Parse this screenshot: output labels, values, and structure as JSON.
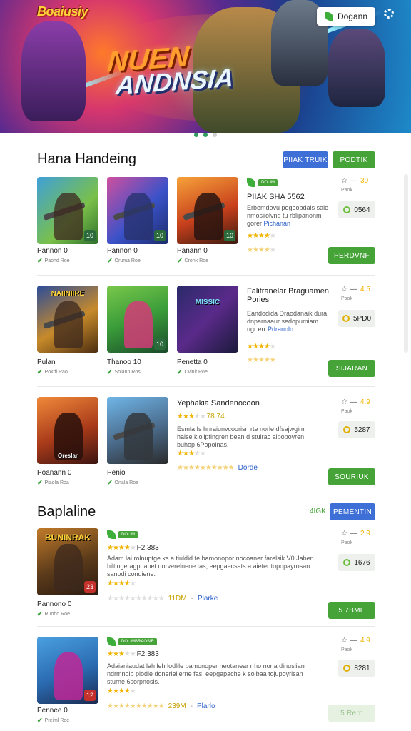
{
  "hero": {
    "logo": "Boaiusiy",
    "title_line1": "NUEN",
    "title_line2": "ANDNSIA",
    "login_label": "Dogann",
    "accent": "#1d8ac9"
  },
  "section1": {
    "title": "Hana Handeing",
    "btn_blue": "PIIAK TRUIK",
    "btn_green": "PODTIK",
    "rows": [
      {
        "games": [
          {
            "name": "Pannon 0",
            "sub": "Paohd Roe",
            "badge": "10"
          },
          {
            "name": "Pannon 0",
            "sub": "Oruma Roe",
            "badge": "10"
          },
          {
            "name": "Panann 0",
            "sub": "Cronk Roe",
            "badge": "10"
          }
        ],
        "tag": "DOLIM",
        "title": "PIIAK SHA 5562",
        "desc1": "Erbemdovu pogeobdals sale",
        "desc2": "nmosiiolvnq tu rblipanonm",
        "desc3": "gorer ",
        "desc_link": "Pichanan",
        "score": "30",
        "score_sub": "Paok",
        "pill": "0564",
        "action": "PERDVNF"
      },
      {
        "games": [
          {
            "name": "Pulan",
            "sub": "Pokdi Rao",
            "badge": "",
            "cap": "NAIINIIRE"
          },
          {
            "name": "Thanoo 10",
            "sub": "Solann Ros",
            "badge": "10"
          },
          {
            "name": "Penetta 0",
            "sub": "Cvinlt Roe",
            "badge": "",
            "cap": "MISSIC"
          }
        ],
        "title": "Falitranelar Braguamen",
        "title2": "Pories",
        "desc1": "Eandodida Draodanaik dura",
        "desc2": "dnparnaaur sedopumiam",
        "desc3": "ugr err ",
        "desc_link": "Pdranolo",
        "score": "4.5",
        "score_sub": "Paok",
        "pill": "5PD0",
        "action": "SIJARAN"
      },
      {
        "games": [
          {
            "name": "Poanann 0",
            "sub": "Piaola Roa",
            "badge": "",
            "cap": "Oreslar"
          },
          {
            "name": "Penio",
            "sub": "Onala Roa",
            "badge": "10"
          }
        ],
        "title": "Yephakia Sandenocoon",
        "rating": "78.74",
        "desc1": "Esmla Is hnraiunvcoorisn rte norle dfsajwgim",
        "desc2": "haise kiolipfingren bean d stulrac aipopoyren",
        "desc3": "buhop 6Popoinas.",
        "meta_link": "Dorde",
        "score": "4.9",
        "score_sub": "Paok",
        "pill": "5287",
        "action": "SOURIUK"
      }
    ]
  },
  "section2": {
    "title": "Baplaline",
    "count_label": "4IGK",
    "btn_blue": "PEMENTIN",
    "rows": [
      {
        "game": {
          "name": "Pannono 0",
          "sub": "Ruohd Roe",
          "cap": "BUNINRAK",
          "badge": "23"
        },
        "tag": "DOLIM",
        "rating": "F2.383",
        "desc1": "Adam lai rolnuptge ks a tiuldid te bamonopor nocoaner farelsik V0 Jaben",
        "desc2": "hiltingeragpnapet dorverelnene tas, eepgaecsats a aieter topopayrosan",
        "desc3": "sanodi condiene.",
        "meta_count": "11DM",
        "meta_link": "Plarke",
        "score": "2.9",
        "score_sub": "Paok",
        "pill": "1676",
        "action": "5 7BME"
      },
      {
        "game": {
          "name": "Pennee 0",
          "sub": "Preiml Roe",
          "cap": "",
          "badge": "12"
        },
        "tag": "DOLIMBRAOSIR",
        "rating": "F2.383",
        "desc1": "Adaianiaudat lah leh lodlile bamonoper neotanear r ho norla dinuslian",
        "desc2": "ndrmnolb plodie doneriellerne fas, eepgapache k solbaa tojupoyrisan",
        "desc3": "sturne 6sorpnosis.",
        "meta_count": "239M",
        "meta_link": "Plarlo",
        "score": "4.9",
        "score_sub": "Paok",
        "pill": "8281",
        "action": "5 Rern"
      }
    ]
  }
}
